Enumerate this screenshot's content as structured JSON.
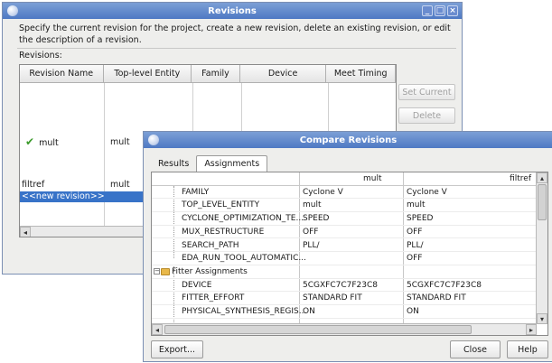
{
  "revisions_window": {
    "title": "Revisions",
    "description": "Specify the current revision for the project, create a new revision, delete an existing revision, or edit the description of a revision.",
    "revisions_label": "Revisions:",
    "columns": [
      "Revision Name",
      "Top-level Entity",
      "Family",
      "Device",
      "Meet Timing"
    ],
    "rows": [
      {
        "name": "mult",
        "entity": "mult",
        "current": true
      },
      {
        "name": "filtref",
        "entity": "mult",
        "current": false
      }
    ],
    "new_revision_label": "<<new revision>>",
    "set_current_label": "Set Current",
    "delete_label": "Delete"
  },
  "compare_window": {
    "title": "Compare Revisions",
    "tabs": [
      "Results",
      "Assignments"
    ],
    "active_tab": "Assignments",
    "columns": [
      "",
      "mult",
      "filtref"
    ],
    "rows": [
      {
        "name": "FAMILY",
        "mult": "Cyclone V",
        "filtref": "Cyclone V"
      },
      {
        "name": "TOP_LEVEL_ENTITY",
        "mult": "mult",
        "filtref": "mult"
      },
      {
        "name": "CYCLONE_OPTIMIZATION_TE...",
        "mult": "SPEED",
        "filtref": "SPEED"
      },
      {
        "name": "MUX_RESTRUCTURE",
        "mult": "OFF",
        "filtref": "OFF"
      },
      {
        "name": "SEARCH_PATH",
        "mult": "PLL/",
        "filtref": "PLL/"
      },
      {
        "name": "EDA_RUN_TOOL_AUTOMATIC...",
        "mult": "",
        "filtref": "OFF"
      },
      {
        "name": "Fitter Assignments",
        "group": true
      },
      {
        "name": "DEVICE",
        "mult": "5CGXFC7C7F23C8",
        "filtref": "5CGXFC7C7F23C8"
      },
      {
        "name": "FITTER_EFFORT",
        "mult": "STANDARD FIT",
        "filtref": "STANDARD FIT"
      },
      {
        "name": "PHYSICAL_SYNTHESIS_REGIS...",
        "mult": "ON",
        "filtref": "ON"
      }
    ],
    "export_label": "Export...",
    "close_label": "Close",
    "help_label": "Help"
  },
  "icons": {
    "check": "check-icon",
    "folder": "folder-icon",
    "collapse": "tree-collapse-icon"
  },
  "colors": {
    "titlebar": "#5a82c8",
    "selection": "#3873c8",
    "check": "#3a9a2a"
  }
}
